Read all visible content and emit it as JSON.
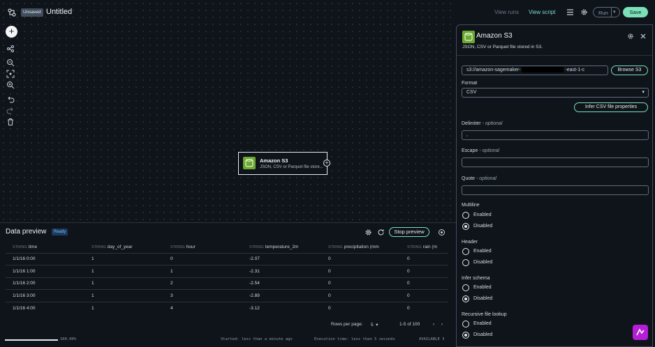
{
  "header": {
    "unsaved_badge": "Unsaved",
    "title": "Untitled",
    "view_runs": "View runs",
    "view_script": "View script",
    "run_label": "Run",
    "save_label": "Save"
  },
  "node": {
    "title": "Amazon S3",
    "subtitle": "JSON, CSV or Parquet file store..."
  },
  "preview": {
    "title": "Data preview",
    "status": "Ready",
    "stop_label": "Stop preview",
    "columns": [
      {
        "type": "STRING",
        "name": "time"
      },
      {
        "type": "STRING",
        "name": "day_of_year"
      },
      {
        "type": "STRING",
        "name": "hour"
      },
      {
        "type": "STRING",
        "name": "temperature_2m"
      },
      {
        "type": "STRING",
        "name": "precipitation (mm"
      },
      {
        "type": "STRING",
        "name": "rain (m"
      }
    ],
    "rows": [
      [
        "1/1/16 0:00",
        "1",
        "0",
        "-2.07",
        "0",
        "0"
      ],
      [
        "1/1/16 1:00",
        "1",
        "1",
        "-2.31",
        "0",
        "0"
      ],
      [
        "1/1/16 2:00",
        "1",
        "2",
        "-2.54",
        "0",
        "0"
      ],
      [
        "1/1/16 3:00",
        "1",
        "3",
        "-2.89",
        "0",
        "0"
      ],
      [
        "1/1/16 4:00",
        "1",
        "4",
        "-3.12",
        "0",
        "0"
      ]
    ],
    "rows_per_page_label": "Rows per page:",
    "rows_per_page": "5",
    "range": "1-5 of 100"
  },
  "status_bar": {
    "progress_text": "100.00%",
    "progress": 1.0,
    "started": "Started: less than a minute ago",
    "execution": "Execution time: less than 5 seconds",
    "available": "AVAILABLE 3"
  },
  "panel": {
    "title": "Amazon S3",
    "subtitle": "JSON, CSV or Parquet file stored in S3.",
    "s3_url_prefix": "s3://amazon-sagemaker-",
    "s3_url_suffix": "-east-1-c",
    "browse_label": "Browse S3",
    "format_label": "Format",
    "format_value": "CSV",
    "infer_label": "Infer CSV file properties",
    "delimiter_label": "Delimiter",
    "delimiter_optional": "- optional",
    "delimiter_value": ",",
    "escape_label": "Escape",
    "escape_optional": "- optional",
    "quote_label": "Quote",
    "quote_optional": "- optional",
    "multiline_label": "Multiline",
    "header_label": "Header",
    "infer_schema_label": "Infer schema",
    "recursive_label": "Recursive file lookup",
    "enabled": "Enabled",
    "disabled": "Disabled"
  }
}
